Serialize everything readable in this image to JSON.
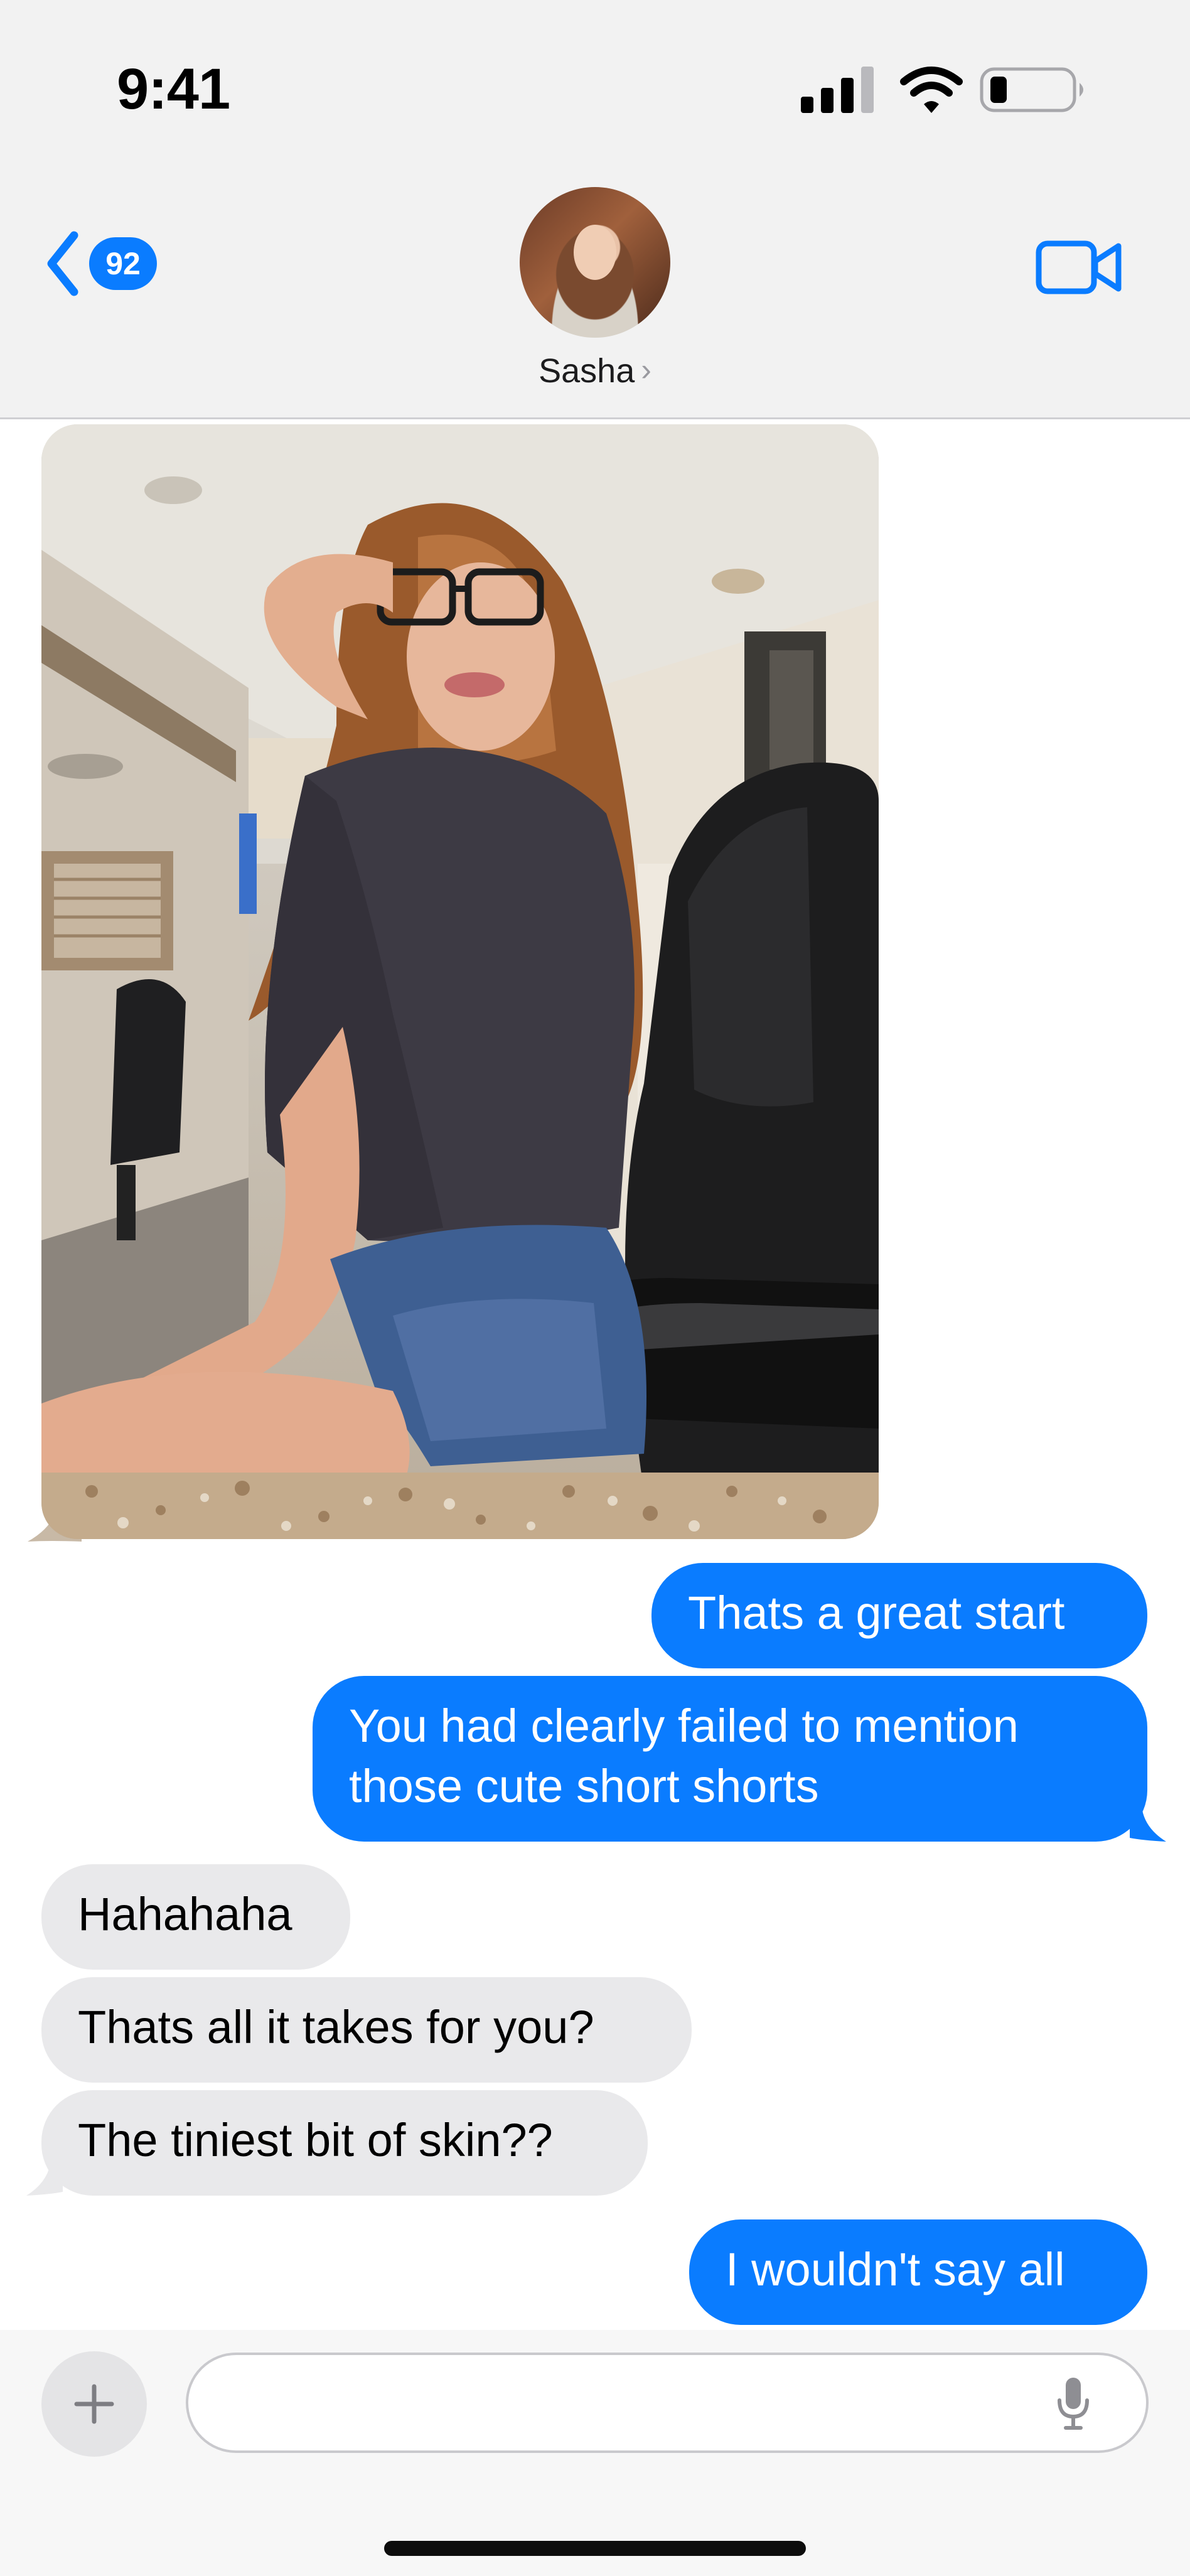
{
  "status_bar": {
    "time": "9:41"
  },
  "header": {
    "back_badge": "92",
    "contact_name": "Sasha",
    "name_chevron": "›"
  },
  "messages": [
    {
      "side": "sent",
      "text": "Thats a great start"
    },
    {
      "side": "sent",
      "text_lines": [
        "You had clearly failed to mention",
        "those cute short shorts"
      ]
    },
    {
      "side": "received",
      "text": "Hahahaha"
    },
    {
      "side": "received",
      "text": "Thats all it takes for you?"
    },
    {
      "side": "received",
      "text": "The tiniest bit of skin??"
    },
    {
      "side": "sent",
      "text": "I wouldn't say all"
    }
  ],
  "input": {
    "value": "",
    "placeholder": ""
  },
  "icons": [
    "signal-icon",
    "wifi-icon",
    "battery-icon",
    "back-chevron-icon",
    "video-camera-icon",
    "plus-icon",
    "microphone-icon"
  ],
  "colors": {
    "sent_bubble": "#0a7cff",
    "received_bubble": "#e9e9eb",
    "header_bg": "#f2f2f2",
    "accent": "#0a7cff"
  }
}
